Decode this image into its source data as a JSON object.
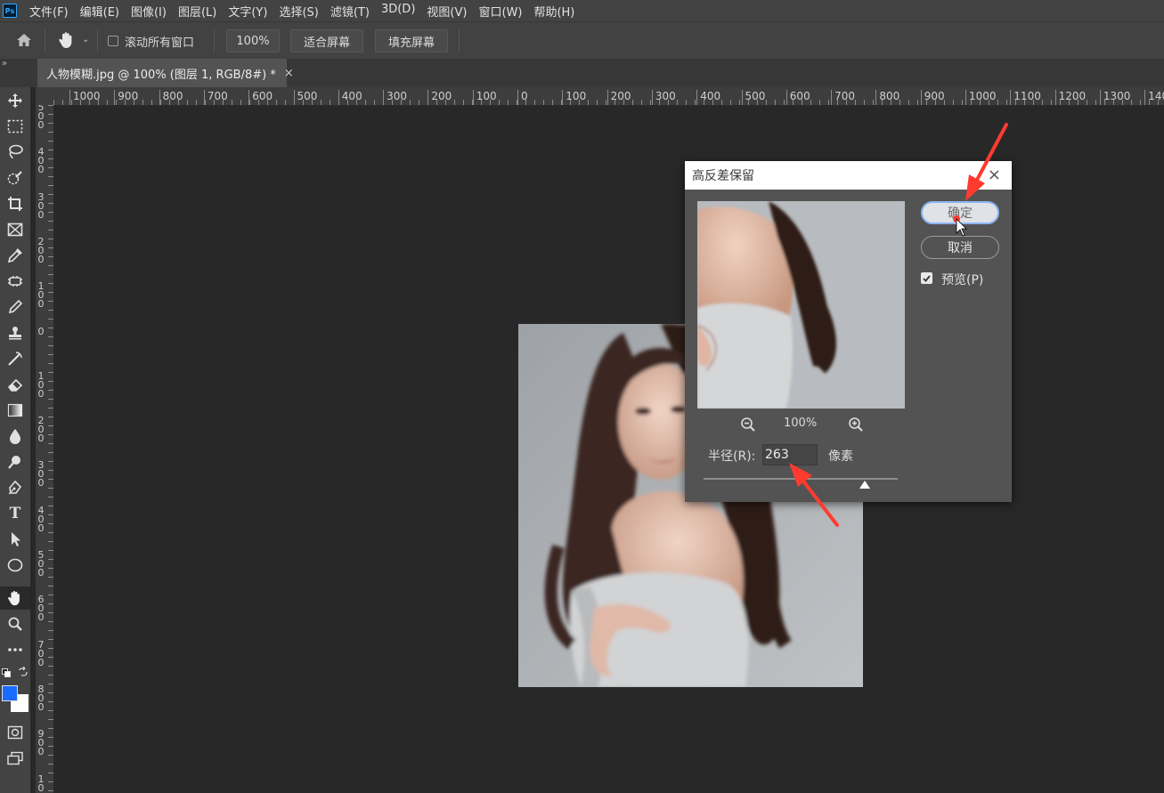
{
  "app": {
    "logo": "Ps"
  },
  "menu": [
    "文件(F)",
    "编辑(E)",
    "图像(I)",
    "图层(L)",
    "文字(Y)",
    "选择(S)",
    "滤镜(T)",
    "3D(D)",
    "视图(V)",
    "窗口(W)",
    "帮助(H)"
  ],
  "options": {
    "scroll_all_label": "滚动所有窗口",
    "scroll_all_checked": false,
    "zoom_button": "100%",
    "fit_screen_button": "适合屏幕",
    "fill_screen_button": "填充屏幕"
  },
  "tab_bar": {
    "collapse": "»"
  },
  "document_tab": {
    "title": "人物模糊.jpg @ 100% (图层 1, RGB/8#) *",
    "close": "×"
  },
  "tools": [
    "move-tool-icon",
    "marquee-tool-icon",
    "lasso-tool-icon",
    "quick-select-tool-icon",
    "crop-tool-icon",
    "frame-tool-icon",
    "eyedropper-tool-icon",
    "healing-brush-tool-icon",
    "brush-tool-icon",
    "clone-stamp-tool-icon",
    "history-brush-tool-icon",
    "eraser-tool-icon",
    "gradient-tool-icon",
    "blur-tool-icon",
    "dodge-tool-icon",
    "pen-tool-icon",
    "type-tool-icon",
    "path-select-tool-icon",
    "ellipse-tool-icon",
    "hand-tool-icon",
    "zoom-tool-icon",
    "more-tools-icon"
  ],
  "type_tool_glyph": "T",
  "colors": {
    "foreground": "#1a6bff",
    "background": "#ffffff",
    "annotation_arrow": "#ff3b30"
  },
  "ruler_h_labels": [
    "1000",
    "900",
    "800",
    "700",
    "600",
    "500",
    "400",
    "300",
    "200",
    "100",
    "0",
    "100",
    "200",
    "300",
    "400",
    "500",
    "600",
    "700",
    "800",
    "900",
    "1000",
    "1100",
    "1200",
    "1300",
    "140"
  ],
  "ruler_v_labels": [
    [
      "5",
      "0",
      "0"
    ],
    [
      "4",
      "0",
      "0"
    ],
    [
      "3",
      "0",
      "0"
    ],
    [
      "2",
      "0",
      "0"
    ],
    [
      "1",
      "0",
      "0"
    ],
    [
      "0"
    ],
    [
      "1",
      "0",
      "0"
    ],
    [
      "2",
      "0",
      "0"
    ],
    [
      "3",
      "0",
      "0"
    ],
    [
      "4",
      "0",
      "0"
    ],
    [
      "5",
      "0",
      "0"
    ],
    [
      "6",
      "0",
      "0"
    ],
    [
      "7",
      "0",
      "0"
    ],
    [
      "8",
      "0",
      "0"
    ],
    [
      "9",
      "0",
      "0"
    ],
    [
      "1",
      "0"
    ]
  ],
  "dialog": {
    "title": "高反差保留",
    "close": "×",
    "ok_button": "确定",
    "cancel_button": "取消",
    "preview_label": "预览(P)",
    "preview_checked": true,
    "zoom": "100%",
    "radius_label": "半径(R):",
    "radius_value": "263",
    "unit": "像素"
  }
}
